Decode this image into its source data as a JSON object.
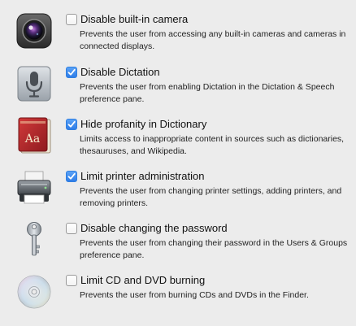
{
  "options": [
    {
      "title": "Disable built-in camera",
      "description": "Prevents the user from accessing any built-in cameras and cameras in connected displays.",
      "checked": false,
      "icon": "camera-icon"
    },
    {
      "title": "Disable Dictation",
      "description": "Prevents the user from enabling Dictation in the Dictation & Speech preference pane.",
      "checked": true,
      "icon": "microphone-icon"
    },
    {
      "title": "Hide profanity in Dictionary",
      "description": "Limits access to inappropriate content in sources such as dictionaries, thesauruses, and Wikipedia.",
      "checked": true,
      "icon": "dictionary-icon",
      "icon_text": "Aa"
    },
    {
      "title": "Limit printer administration",
      "description": "Prevents the user from changing printer settings, adding printers, and removing printers.",
      "checked": true,
      "icon": "printer-icon"
    },
    {
      "title": "Disable changing the password",
      "description": "Prevents the user from changing their password in the Users & Groups preference pane.",
      "checked": false,
      "icon": "key-icon"
    },
    {
      "title": "Limit CD and DVD burning",
      "description": "Prevents the user from burning CDs and DVDs in the Finder.",
      "checked": false,
      "icon": "disc-icon"
    }
  ],
  "colors": {
    "background": "#ececec",
    "checkbox_checked": "#2f7de8",
    "dictionary_red": "#b3262a"
  }
}
